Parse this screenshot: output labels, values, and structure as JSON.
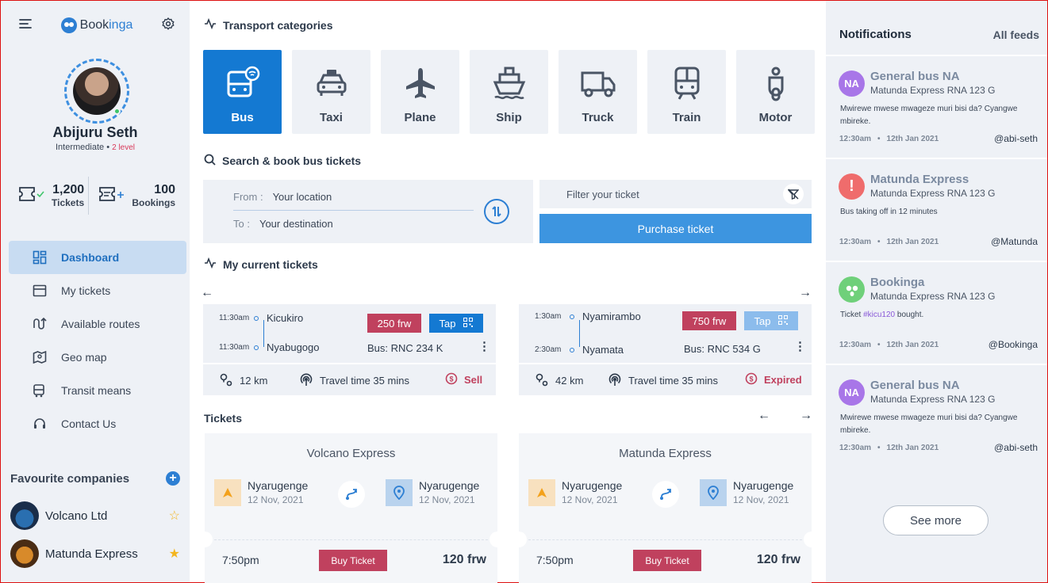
{
  "brand": {
    "name_part1": "Book",
    "name_part2": "inga"
  },
  "user": {
    "name": "Abijuru Seth",
    "level_text": "Intermediate",
    "level_detail": "2 level"
  },
  "stats": [
    {
      "value": "1,200",
      "label": "Tickets"
    },
    {
      "value": "100",
      "label": "Bookings"
    }
  ],
  "nav": [
    {
      "label": "Dashboard",
      "icon": "dashboard-icon"
    },
    {
      "label": "My tickets",
      "icon": "ticket-icon"
    },
    {
      "label": "Available routes",
      "icon": "routes-icon"
    },
    {
      "label": "Geo map",
      "icon": "map-icon"
    },
    {
      "label": "Transit means",
      "icon": "bus-icon"
    },
    {
      "label": "Contact Us",
      "icon": "headset-icon"
    }
  ],
  "favourites": {
    "title": "Favourite companies",
    "items": [
      {
        "name": "Volcano Ltd"
      },
      {
        "name": "Matunda Express"
      }
    ]
  },
  "categories": {
    "title": "Transport categories",
    "items": [
      {
        "label": "Bus"
      },
      {
        "label": "Taxi"
      },
      {
        "label": "Plane"
      },
      {
        "label": "Ship"
      },
      {
        "label": "Truck"
      },
      {
        "label": "Train"
      },
      {
        "label": "Motor"
      }
    ]
  },
  "search": {
    "title": "Search & book bus tickets",
    "from_label": "From :",
    "from_value": "Your location",
    "to_label": "To :",
    "to_value": "Your destination",
    "filter_placeholder": "Filter your ticket",
    "purchase_label": "Purchase ticket"
  },
  "current_tickets": {
    "title": "My current tickets",
    "items": [
      {
        "dep_time": "11:30am",
        "dep_place": "Kicukiro",
        "arr_time": "11:30am",
        "arr_place": "Nyabugogo",
        "price": "250 frw",
        "tap": "Tap",
        "bus": "Bus: RNC 234 K",
        "distance": "12 km",
        "travel": "Travel time 35 mins",
        "status": "Sell"
      },
      {
        "dep_time": "1:30am",
        "dep_place": "Nyamirambo",
        "arr_time": "2:30am",
        "arr_place": "Nyamata",
        "price": "750 frw",
        "tap": "Tap",
        "bus": "Bus: RNC 534 G",
        "distance": "42 km",
        "travel": "Travel time 35 mins",
        "status": "Expired"
      }
    ]
  },
  "tickets": {
    "title": "Tickets",
    "items": [
      {
        "company": "Volcano Express",
        "from": "Nyarugenge",
        "from_date": "12 Nov, 2021",
        "to": "Nyarugenge",
        "to_date": "12 Nov, 2021",
        "time": "7:50pm",
        "buy": "Buy Ticket",
        "price": "120 frw"
      },
      {
        "company": "Matunda Express",
        "from": "Nyarugenge",
        "from_date": "12 Nov, 2021",
        "to": "Nyarugenge",
        "to_date": "12 Nov, 2021",
        "time": "7:50pm",
        "buy": "Buy Ticket",
        "price": "120 frw"
      }
    ]
  },
  "notifications": {
    "title": "Notifications",
    "feeds": "All feeds",
    "items": [
      {
        "avatar": "NA",
        "name": "General bus NA",
        "sub": "Matunda Express RNA 123 G",
        "msg": "Mwirewe mwese mwageze muri bisi da? Cyangwe mbireke.",
        "time": "12:30am",
        "date": "12th Jan 2021",
        "handle": "@abi-seth"
      },
      {
        "avatar": "!",
        "name": "Matunda Express",
        "sub": "Matunda Express RNA 123 G",
        "msg": "Bus taking off in 12 minutes",
        "time": "12:30am",
        "date": "12th Jan 2021",
        "handle": "@Matunda"
      },
      {
        "avatar": "",
        "name": "Bookinga",
        "sub": "Matunda Express RNA 123 G",
        "msg_pre": "Ticket ",
        "msg_tag": "#kicu120",
        "msg_post": " bought.",
        "time": "12:30am",
        "date": "12th Jan 2021",
        "handle": "@Bookinga"
      },
      {
        "avatar": "NA",
        "name": "General bus NA",
        "sub": "Matunda Express RNA 123 G",
        "msg": "Mwirewe mwese mwageze muri bisi da? Cyangwe mbireke.",
        "time": "12:30am",
        "date": "12th Jan 2021",
        "handle": "@abi-seth"
      }
    ],
    "see_more": "See more"
  },
  "colors": {
    "accent": "#1479d2",
    "danger": "#c0415e",
    "sidebar_bg": "#eef1f6"
  }
}
